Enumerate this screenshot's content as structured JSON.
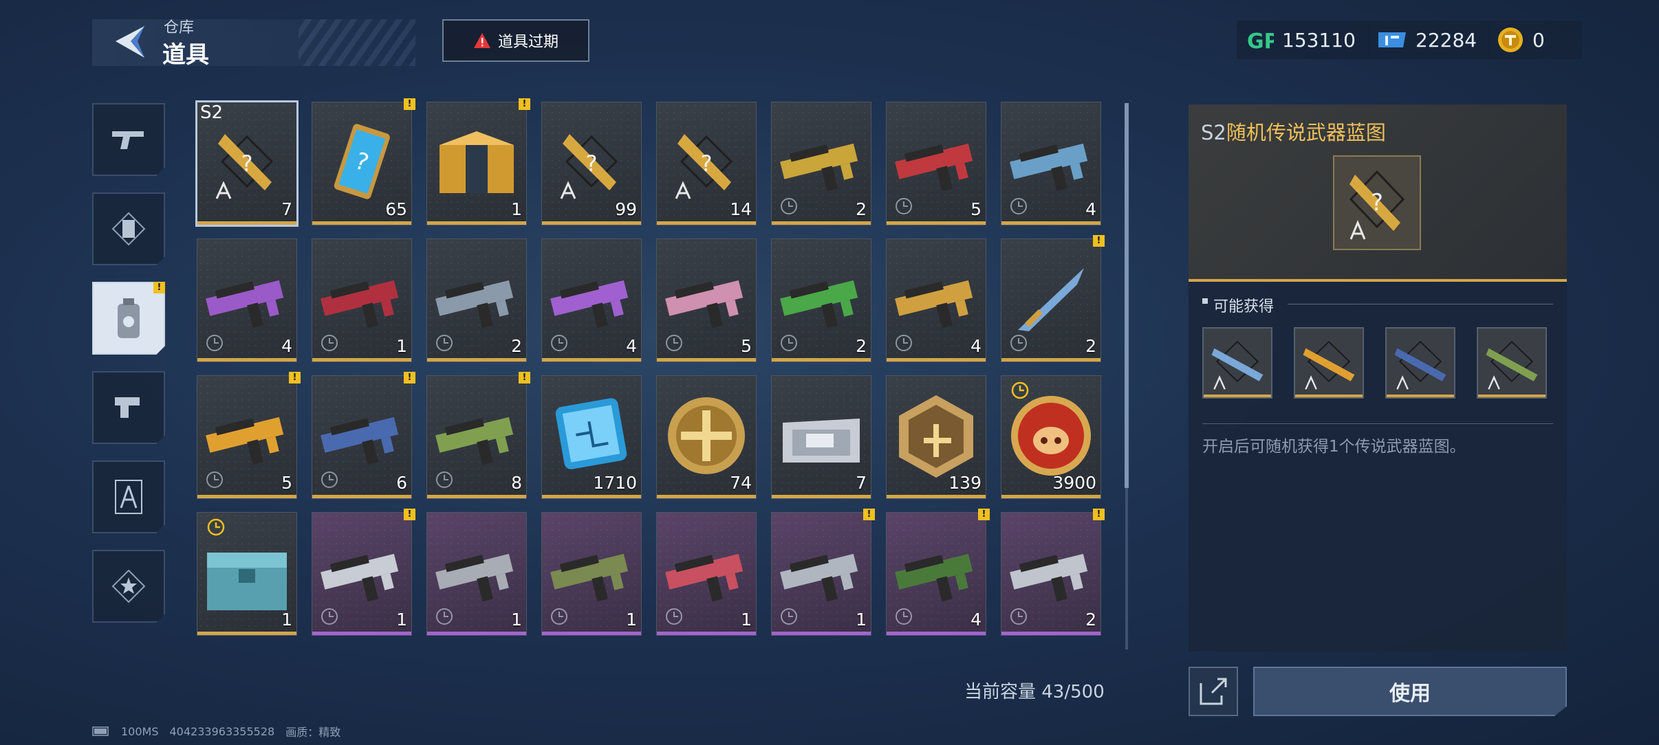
{
  "header": {
    "breadcrumb_small": "仓库",
    "breadcrumb_big": "道具",
    "expire_label": "道具过期"
  },
  "currencies": {
    "gp": "153110",
    "ticket": "22284",
    "gold": "0"
  },
  "items": [
    {
      "count": "7",
      "tag": "S2",
      "art": "blueprint",
      "tier": "gold",
      "selected": true
    },
    {
      "count": "65",
      "art": "card",
      "tier": "gold",
      "badge": true
    },
    {
      "count": "1",
      "art": "crate",
      "tier": "gold",
      "badge": true
    },
    {
      "count": "99",
      "art": "blueprint",
      "tier": "gold"
    },
    {
      "count": "14",
      "art": "blueprint",
      "tier": "gold"
    },
    {
      "count": "2",
      "art": "gun",
      "color": "#c9a53a",
      "tier": "gold",
      "clock": true
    },
    {
      "count": "5",
      "art": "gun",
      "color": "#c0393f",
      "tier": "gold",
      "clock": true
    },
    {
      "count": "4",
      "art": "gun",
      "color": "#6aa0c8",
      "tier": "gold",
      "clock": true
    },
    {
      "count": "4",
      "art": "gun",
      "color": "#9a5ac8",
      "tier": "gold",
      "clock": true
    },
    {
      "count": "1",
      "art": "gun",
      "color": "#b03040",
      "tier": "gold",
      "clock": true
    },
    {
      "count": "2",
      "art": "gun",
      "color": "#8a9aaa",
      "tier": "gold",
      "clock": true
    },
    {
      "count": "4",
      "art": "gun",
      "color": "#a060d0",
      "tier": "gold",
      "clock": true
    },
    {
      "count": "5",
      "art": "gun",
      "color": "#d090b0",
      "tier": "gold",
      "clock": true
    },
    {
      "count": "2",
      "art": "gun",
      "color": "#4aa848",
      "tier": "gold",
      "clock": true
    },
    {
      "count": "4",
      "art": "gun",
      "color": "#d0a040",
      "tier": "gold",
      "clock": true
    },
    {
      "count": "2",
      "art": "knife",
      "color": "#7aa8d8",
      "tier": "gold",
      "clock": true,
      "badge": true
    },
    {
      "count": "5",
      "art": "gun",
      "color": "#e0a030",
      "tier": "gold",
      "clock": true,
      "badge": true
    },
    {
      "count": "6",
      "art": "gun",
      "color": "#4a6ab0",
      "tier": "gold",
      "clock": true,
      "badge": true
    },
    {
      "count": "8",
      "art": "gun",
      "color": "#80a050",
      "tier": "gold",
      "clock": true,
      "badge": true
    },
    {
      "count": "1710",
      "art": "chip",
      "tier": "gold"
    },
    {
      "count": "74",
      "art": "coin",
      "tier": "gold"
    },
    {
      "count": "7",
      "art": "ticket",
      "tier": "gold"
    },
    {
      "count": "139",
      "art": "medal",
      "tier": "gold"
    },
    {
      "count": "3900",
      "art": "pig",
      "tier": "gold",
      "timer": true
    },
    {
      "count": "1",
      "art": "box",
      "tier": "gold",
      "timer": true
    },
    {
      "count": "1",
      "art": "gun",
      "color": "#c8ccd4",
      "tier": "purple",
      "clock": true,
      "badge": true
    },
    {
      "count": "1",
      "art": "gun",
      "color": "#a8acb4",
      "tier": "purple",
      "clock": true
    },
    {
      "count": "1",
      "art": "gun",
      "color": "#7a8a50",
      "tier": "purple",
      "clock": true
    },
    {
      "count": "1",
      "art": "gun",
      "color": "#c85060",
      "tier": "purple",
      "clock": true
    },
    {
      "count": "1",
      "art": "gun",
      "color": "#b0b6c0",
      "tier": "purple",
      "clock": true,
      "badge": true
    },
    {
      "count": "4",
      "art": "gun",
      "color": "#4a7a3a",
      "tier": "purple",
      "clock": true,
      "badge": true
    },
    {
      "count": "2",
      "art": "gun",
      "color": "#c0c4cc",
      "tier": "purple",
      "clock": true,
      "badge": true
    }
  ],
  "capacity": "当前容量 43/500",
  "detail": {
    "title_prefix": "S2",
    "title_main": "随机传说武器蓝图",
    "possible_heading": "可能获得",
    "description": "开启后可随机获得1个传说武器蓝图。",
    "rewards": [
      {
        "color": "#7aa8d8"
      },
      {
        "color": "#e0a030"
      },
      {
        "color": "#4a6ab0"
      },
      {
        "color": "#80a050"
      }
    ]
  },
  "use_label": "使用",
  "footer": {
    "ping": "100MS",
    "uid": "404233963355528",
    "quality": "画质：精致"
  },
  "colors": {
    "gold_border": "#d2a64a",
    "purple_border": "#a364cf",
    "title_gold": "#f0c05a",
    "badge_yellow": "#f0c020"
  }
}
